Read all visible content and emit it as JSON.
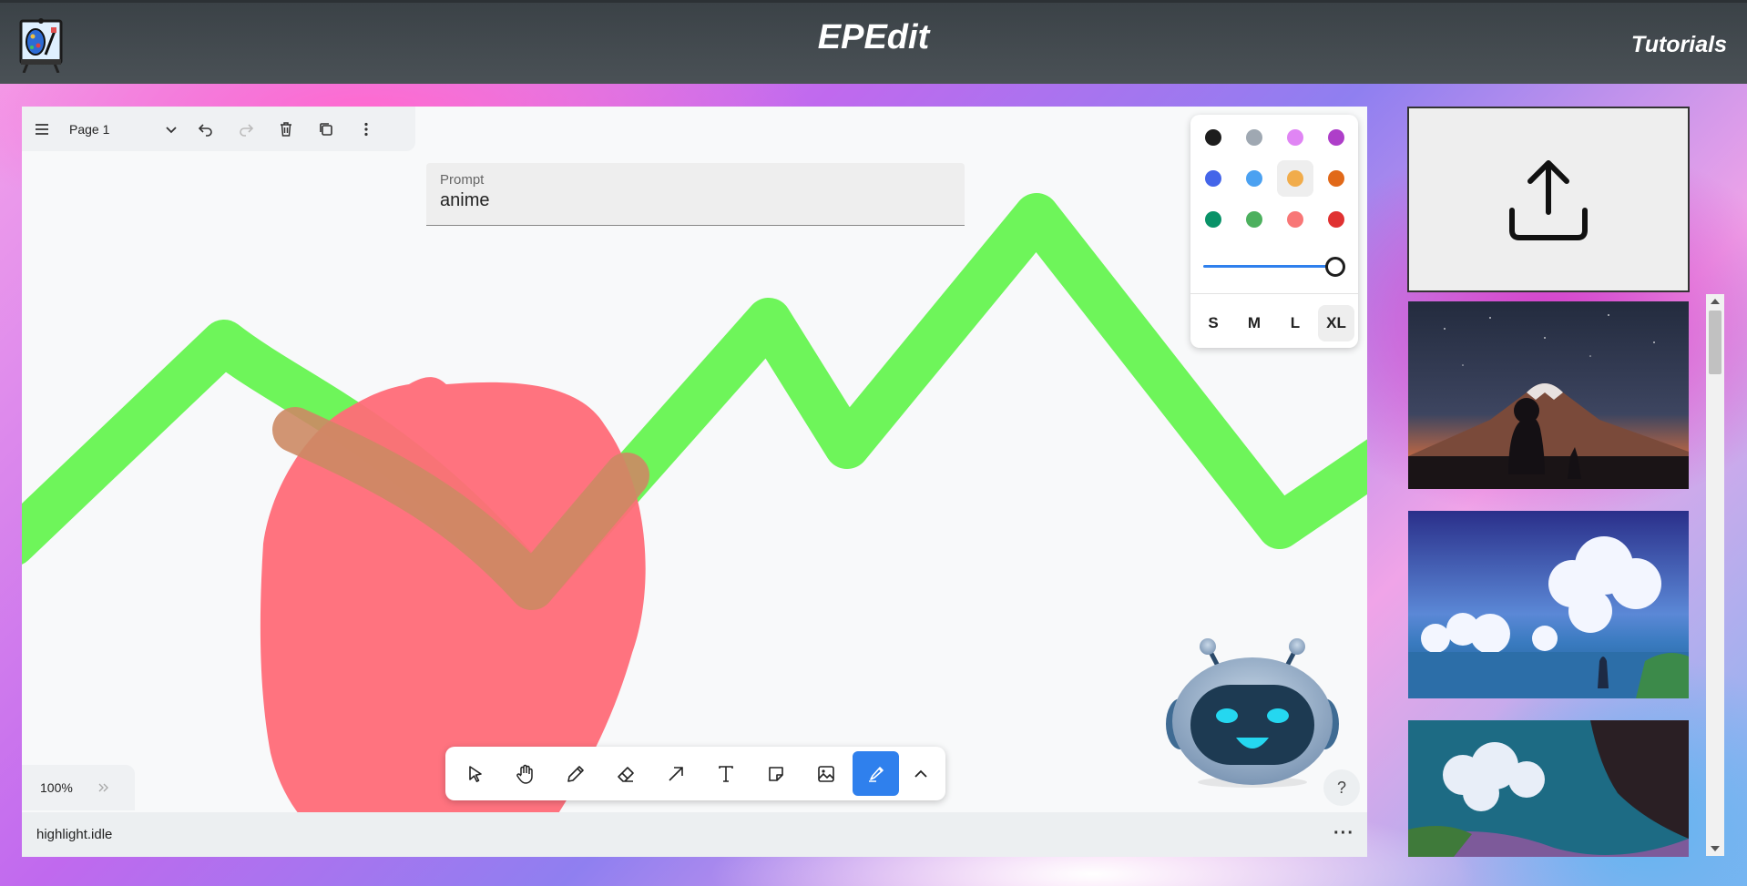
{
  "header": {
    "title": "EPEdit",
    "tutorials_label": "Tutorials"
  },
  "editor": {
    "page_name": "Page 1",
    "prompt": {
      "label": "Prompt",
      "value": "anime"
    },
    "zoom": "100%",
    "status": "highlight.idle",
    "help_label": "?",
    "more_label": "···"
  },
  "style_panel": {
    "colors": [
      "#1d1d1d",
      "#9fa8b2",
      "#e085f4",
      "#ae3ec9",
      "#4465e9",
      "#4ba1f1",
      "#f1ac4b",
      "#e16919",
      "#099268",
      "#4cb05e",
      "#f87777",
      "#e03131"
    ],
    "selected_color": "#f1ac4b",
    "sizes": [
      "S",
      "M",
      "L",
      "XL"
    ],
    "selected_size": "XL",
    "opacity_level": 1.0
  },
  "tools": [
    "select",
    "hand",
    "draw",
    "eraser",
    "arrow",
    "text",
    "note",
    "asset",
    "highlight",
    "more"
  ],
  "active_tool": "highlight",
  "gallery": {
    "items": [
      "mount-fuji-silhouette",
      "cumulus-clouds-seaside",
      "dramatic-sky-landscape"
    ]
  },
  "strokes": {
    "highlight_color": "#6ef55a",
    "shape_fill": "#ff6b78"
  }
}
